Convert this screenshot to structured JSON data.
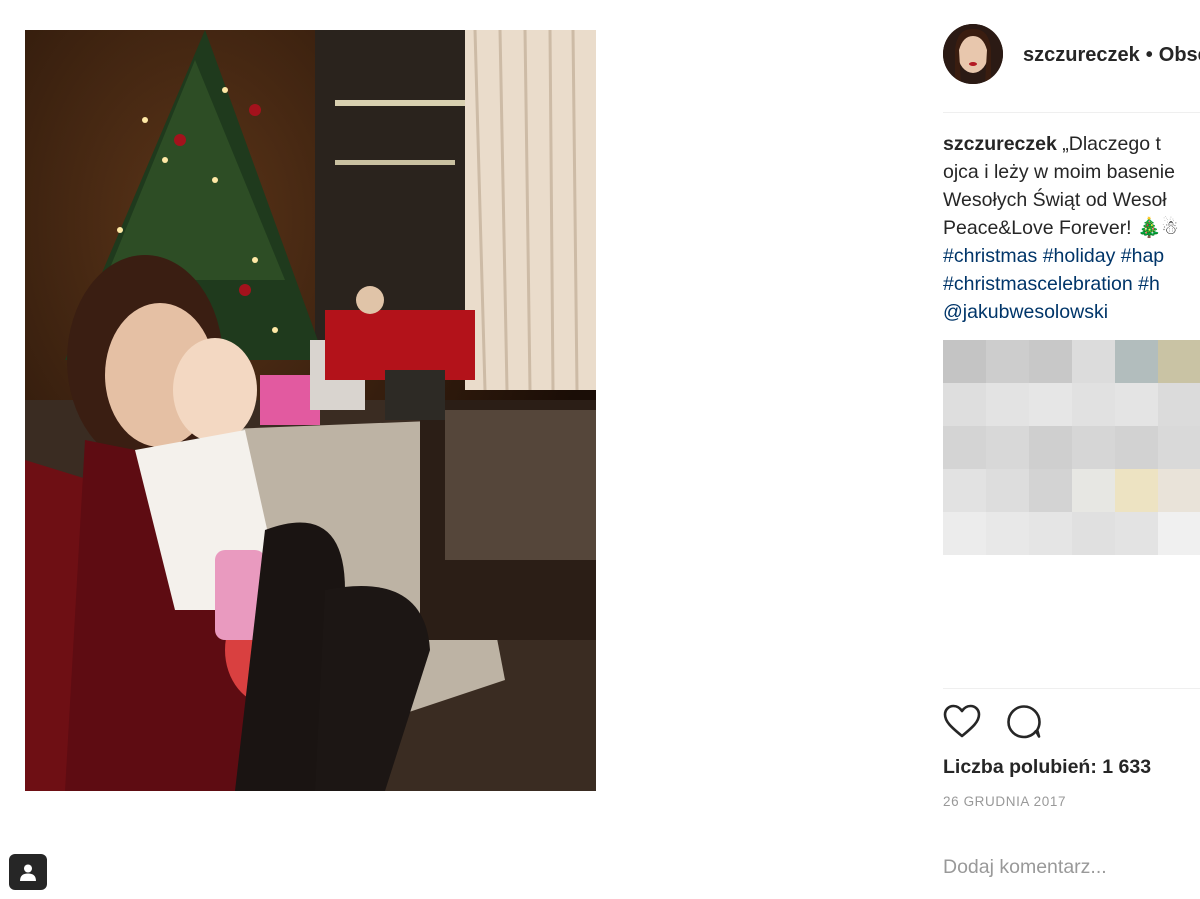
{
  "header": {
    "username": "szczureczek",
    "separator": "•",
    "follow_label": "Obserwuj"
  },
  "caption": {
    "username": "szczureczek",
    "line1": "„Dlaczego t",
    "line2": "ojca i leży w moim basenie",
    "line3": "Wesołych Świąt od Wesoł",
    "line4": "Peace&Love Forever! 🎄☃",
    "line5_tags": [
      "#christmas",
      "#holiday",
      "#hap"
    ],
    "line6_tags": [
      "#christmascelebration",
      "#h"
    ],
    "mention": "@jakubwesolowski"
  },
  "likes_text": "Liczba polubień: 1 633",
  "date_text": "26 GRUDNIA 2017",
  "comment": {
    "placeholder": "Dodaj komentarz..."
  },
  "icons": {
    "like": "heart-outline-icon",
    "comment": "speech-bubble-icon",
    "tag_people": "person-tag-icon"
  },
  "colors": {
    "text": "#262626",
    "secondary_text": "#999999",
    "hashtag": "#003569",
    "divider": "#efefef"
  },
  "pixelated_comments_colors": [
    "#c4c4c4",
    "#cdcdcd",
    "#c8c8c8",
    "#dcdcdc",
    "#b2bdbd",
    "#c9c3a4",
    "#dedede",
    "#e3e3e3",
    "#e6e6e6",
    "#e1e1e1",
    "#e4e4e4",
    "#dbdbdb",
    "#d4d4d4",
    "#d8d8d8",
    "#cfcfcf",
    "#d6d6d6",
    "#d2d2d2",
    "#d9d9d9",
    "#e2e2e2",
    "#dddddd",
    "#d3d3d3",
    "#e7e7e3",
    "#ede3c2",
    "#e9e3d9",
    "#ececec",
    "#e8e8e8",
    "#e5e5e5",
    "#e0e0e0",
    "#e3e3e3",
    "#f0f0f0"
  ]
}
